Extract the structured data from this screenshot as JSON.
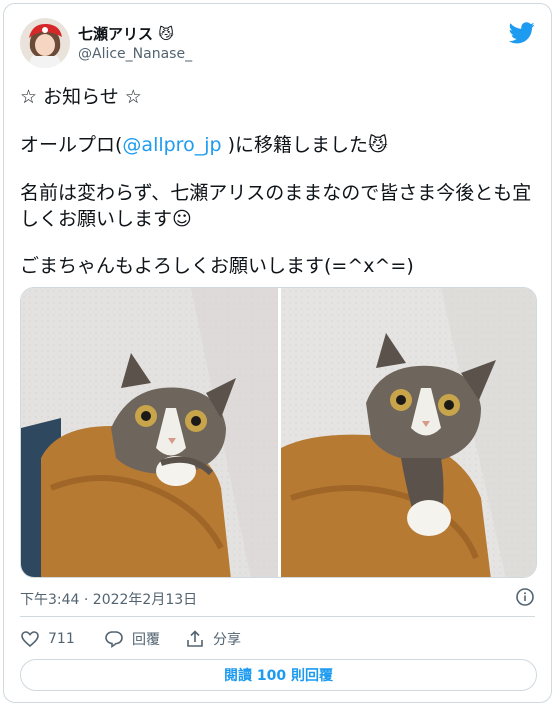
{
  "author": {
    "display_name": "七瀬アリス 😼",
    "handle": "@Alice_Nanase_"
  },
  "tweet": {
    "line1": "☆ お知らせ ☆",
    "line2_before": "オールプロ(",
    "line2_mention": "@allpro_jp",
    "line2_after": " )に移籍しました😼",
    "line3": "名前は変わらず、七瀬アリスのままなので皆さま今後とも宜しくお願いします☺",
    "line4": "ごまちゃんもよろしくお願いします(=^x^=)"
  },
  "meta": {
    "timestamp": "下午3:44 · 2022年2月13日"
  },
  "actions": {
    "likes": "711",
    "reply_label": "回覆",
    "share_label": "分享"
  },
  "read_replies_label": "閱讀 100 則回覆",
  "colors": {
    "accent": "#1d9bf0",
    "muted": "#536471",
    "border": "#cfd9de"
  }
}
